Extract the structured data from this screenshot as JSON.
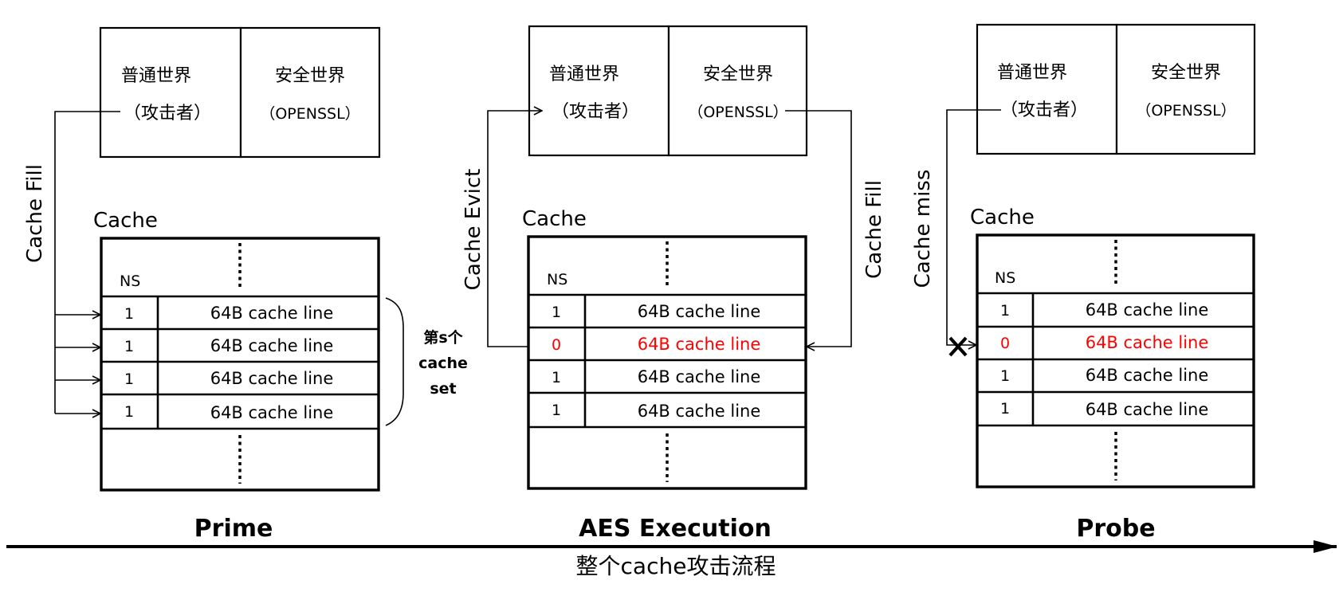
{
  "colors": {
    "accent_red": "#ff0000",
    "line": "#000000"
  },
  "phases": [
    {
      "title": "Prime",
      "normal_world": {
        "line1": "普通世界",
        "line2": "（攻击者）"
      },
      "secure_world": {
        "line1": "安全世界",
        "line2": "（OPENSSL）"
      },
      "cache_label": "Cache",
      "ns_header": "NS",
      "rows": [
        {
          "ns": "1",
          "label": "64B cache line",
          "highlight": false
        },
        {
          "ns": "1",
          "label": "64B cache line",
          "highlight": false
        },
        {
          "ns": "1",
          "label": "64B cache line",
          "highlight": false
        },
        {
          "ns": "1",
          "label": "64B cache line",
          "highlight": false
        }
      ],
      "left_arrow_label": "Cache Fill",
      "set_label": {
        "line1": "第s个",
        "line2": "cache",
        "line3": "set"
      }
    },
    {
      "title": "AES Execution",
      "normal_world": {
        "line1": "普通世界",
        "line2": "（攻击者）"
      },
      "secure_world": {
        "line1": "安全世界",
        "line2": "（OPENSSL）"
      },
      "cache_label": "Cache",
      "ns_header": "NS",
      "rows": [
        {
          "ns": "1",
          "label": "64B cache line",
          "highlight": false
        },
        {
          "ns": "0",
          "label": "64B cache line",
          "highlight": true
        },
        {
          "ns": "1",
          "label": "64B cache line",
          "highlight": false
        },
        {
          "ns": "1",
          "label": "64B cache line",
          "highlight": false
        }
      ],
      "left_arrow_label": "Cache Evict",
      "right_arrow_label": "Cache Fill"
    },
    {
      "title": "Probe",
      "normal_world": {
        "line1": "普通世界",
        "line2": "（攻击者）"
      },
      "secure_world": {
        "line1": "安全世界",
        "line2": "（OPENSSL）"
      },
      "cache_label": "Cache",
      "ns_header": "NS",
      "rows": [
        {
          "ns": "1",
          "label": "64B cache line",
          "highlight": false
        },
        {
          "ns": "0",
          "label": "64B cache line",
          "highlight": true
        },
        {
          "ns": "1",
          "label": "64B cache line",
          "highlight": false
        },
        {
          "ns": "1",
          "label": "64B cache line",
          "highlight": false
        }
      ],
      "left_arrow_label": "Cache miss"
    }
  ],
  "timeline_label": "整个cache攻击流程"
}
